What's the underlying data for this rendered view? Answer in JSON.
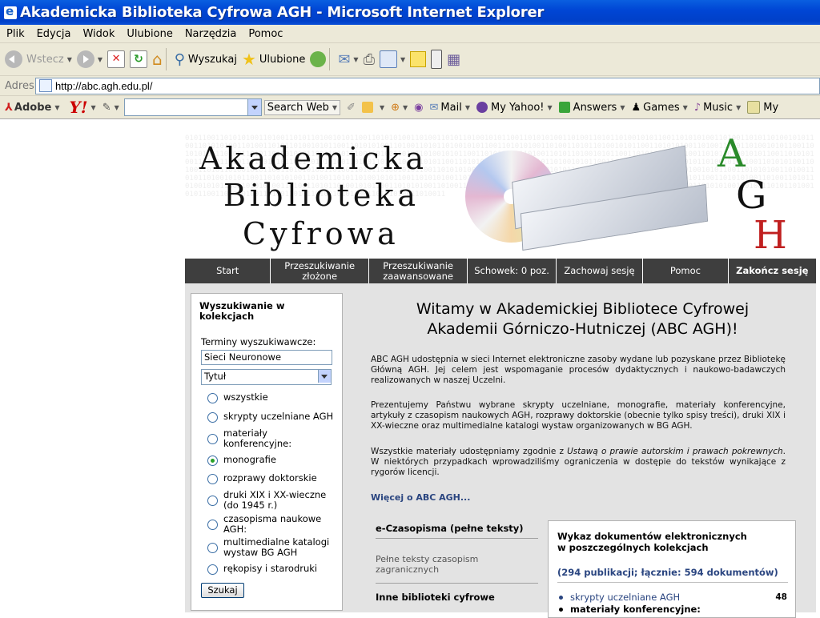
{
  "window": {
    "title": "Akademicka Biblioteka Cyfrowa AGH - Microsoft Internet Explorer"
  },
  "menu": [
    "Plik",
    "Edycja",
    "Widok",
    "Ulubione",
    "Narzędzia",
    "Pomoc"
  ],
  "toolbar": {
    "back_label": "Wstecz",
    "search_label": "Wyszukaj",
    "favorites_label": "Ulubione"
  },
  "address": {
    "label": "Adres",
    "url": "http://abc.agh.edu.pl/"
  },
  "yahoo_toolbar": {
    "adobe_label": "Adobe",
    "search_web_label": "Search Web",
    "mail_label": "Mail",
    "my_yahoo_label": "My Yahoo!",
    "answers_label": "Answers",
    "games_label": "Games",
    "music_label": "Music",
    "my_label": "My"
  },
  "banner": {
    "line1": "Akademicka",
    "line2": "Biblioteka",
    "line3": "Cyfrowa",
    "agh": [
      "A",
      "G",
      "H"
    ]
  },
  "nav": [
    {
      "label": "Start"
    },
    {
      "label": "Przeszukiwanie złożone"
    },
    {
      "label": "Przeszukiwanie zaawansowane"
    },
    {
      "label": "Schowek: 0 poz."
    },
    {
      "label": "Zachowaj sesję"
    },
    {
      "label": "Pomoc"
    },
    {
      "label": "Zakończ sesję"
    }
  ],
  "search_panel": {
    "title": "Wyszukiwanie w kolekcjach",
    "terms_label": "Terminy wyszukiwawcze:",
    "terms_value": "Sieci Neuronowe",
    "field_select": "Tytuł",
    "options": [
      {
        "label": "wszystkie",
        "selected": false
      },
      {
        "label": "skrypty uczelniane AGH",
        "selected": false
      },
      {
        "label": "materiały konferencyjne:",
        "selected": false
      },
      {
        "label": "monografie",
        "selected": true
      },
      {
        "label": "rozprawy doktorskie",
        "selected": false
      },
      {
        "label": "druki XIX i XX-wieczne (do 1945 r.)",
        "selected": false
      },
      {
        "label": "czasopisma naukowe AGH:",
        "selected": false
      },
      {
        "label": "multimedialne katalogi wystaw BG AGH",
        "selected": false
      },
      {
        "label": "rękopisy i starodruki",
        "selected": false
      }
    ],
    "button_label": "Szukaj"
  },
  "main": {
    "welcome_line1": "Witamy w Akademickiej Bibliotece Cyfrowej",
    "welcome_line2": "Akademii Górniczo-Hutniczej (ABC AGH)!",
    "para1": "ABC AGH udostępnia w sieci Internet elektroniczne zasoby wydane lub pozyskane przez Bibliotekę Główną AGH. Jej celem jest wspomaganie procesów dydaktycznych i naukowo-badawczych realizowanych w naszej Uczelni.",
    "para2": "Prezentujemy Państwu wybrane skrypty uczelniane, monografie, materiały konferencyjne, artykuły z czasopism naukowych AGH, rozprawy doktorskie (obecnie tylko spisy treści), druki XIX i XX-wieczne oraz multimedialne katalogi wystaw organizowanych w BG AGH.",
    "para3_before": "Wszystkie materiały udostępniamy zgodnie z ",
    "para3_italic": "Ustawą o prawie autorskim i prawach pokrewnych",
    "para3_after": ". W niektórych przypadkach wprowadziliśmy ograniczenia w dostępie do tekstów wynikające z rygorów licencji.",
    "more_link": "Więcej o ABC AGH...",
    "ejournals_heading": "e-Czasopisma (pełne teksty)",
    "ejournals_link": "Pełne teksty czasopism zagranicznych",
    "other_heading": "Inne biblioteki cyfrowe"
  },
  "collections": {
    "title_line1": "Wykaz dokumentów elektronicznych",
    "title_line2": "w poszczególnych kolekcjach",
    "count_text": "(294 publikacji; łącznie: 594 dokumentów)",
    "items": [
      {
        "name": "skrypty uczelniane AGH",
        "count": "48"
      },
      {
        "name": "materiały konferencyjne:",
        "count": ""
      }
    ]
  }
}
